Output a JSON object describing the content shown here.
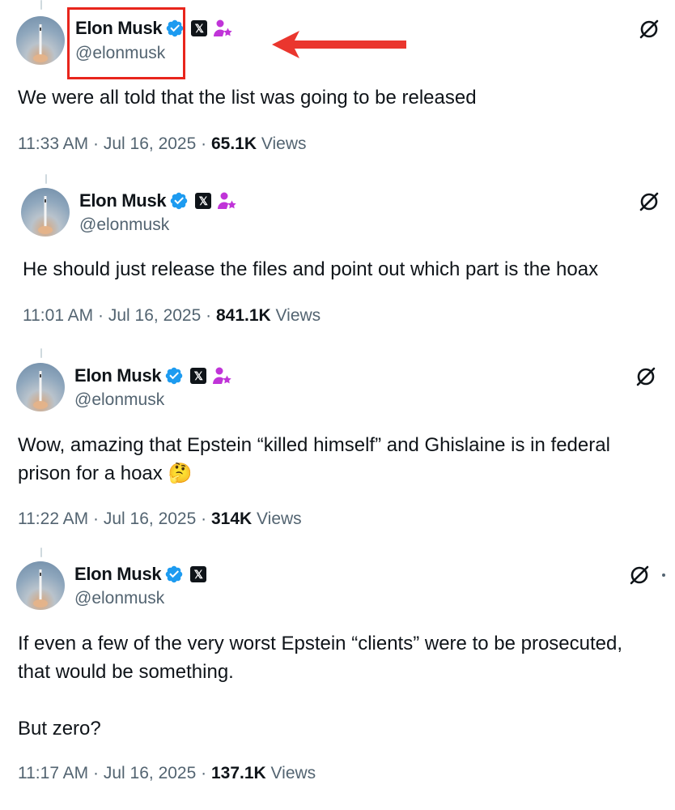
{
  "annotation": {
    "highlight_color": "#e8251c"
  },
  "colors": {
    "verified": "#1d9bf0",
    "affiliate": "#c034d8",
    "secondary_text": "#536471"
  },
  "tweets": [
    {
      "author": {
        "name": "Elon Musk",
        "handle": "@elonmusk",
        "avatar_icon": "rocket-avatar"
      },
      "text": [
        "We were all told that the list was going to be released"
      ],
      "time": "11:33 AM",
      "date": "Jul 16, 2025",
      "views_count": "65.1K",
      "views_label": "Views"
    },
    {
      "author": {
        "name": "Elon Musk",
        "handle": "@elonmusk",
        "avatar_icon": "rocket-avatar"
      },
      "text": [
        "He should just release the files and point out which part is the hoax"
      ],
      "time": "11:01 AM",
      "date": "Jul 16, 2025",
      "views_count": "841.1K",
      "views_label": "Views"
    },
    {
      "author": {
        "name": "Elon Musk",
        "handle": "@elonmusk",
        "avatar_icon": "rocket-avatar"
      },
      "text": [
        "Wow, amazing that Epstein “killed himself” and Ghislaine is in federal",
        "prison for a hoax 🤔"
      ],
      "time": "11:22 AM",
      "date": "Jul 16, 2025",
      "views_count": "314K",
      "views_label": "Views"
    },
    {
      "author": {
        "name": "Elon Musk",
        "handle": "@elonmusk",
        "avatar_icon": "rocket-avatar"
      },
      "text": [
        "If even a few of the very worst Epstein “clients” were to be prosecuted,",
        "that would be something.",
        "",
        "But zero?"
      ],
      "time": "11:17 AM",
      "date": "Jul 16, 2025",
      "views_count": "137.1K",
      "views_label": "Views"
    }
  ],
  "icons": {
    "verified": "verified-badge-icon",
    "x_logo": "x-logo-icon",
    "affiliate": "affiliate-badge-icon",
    "grok": "grok-icon",
    "x_glyph": "𝕏",
    "separator": "·"
  }
}
